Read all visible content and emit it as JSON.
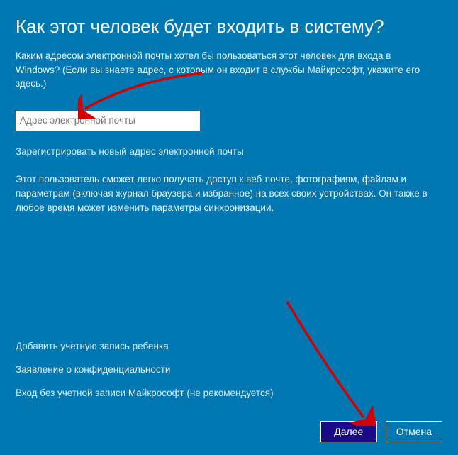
{
  "title": "Как этот человек будет входить в систему?",
  "subtitle": "Каким адресом электронной почты хотел бы пользоваться этот человек для входа в Windows? (Если вы знаете адрес, с которым он входит в службы Майкрософт, укажите его здесь.)",
  "email": {
    "placeholder": "Адрес электронной почты",
    "value": ""
  },
  "links": {
    "register": "Зарегистрировать новый адрес электронной почты",
    "info": "Этот пользователь сможет легко получать доступ к веб-почте, фотографиям, файлам и параметрам (включая журнал браузера и избранное) на всех своих устройствах. Он также в любое время может изменить параметры синхронизации.",
    "addChild": "Добавить учетную запись ребенка",
    "privacy": "Заявление о конфиденциальности",
    "noAccount": "Вход без учетной записи Майкрософт (не рекомендуется)"
  },
  "buttons": {
    "next": "Далее",
    "cancel": "Отмена"
  }
}
